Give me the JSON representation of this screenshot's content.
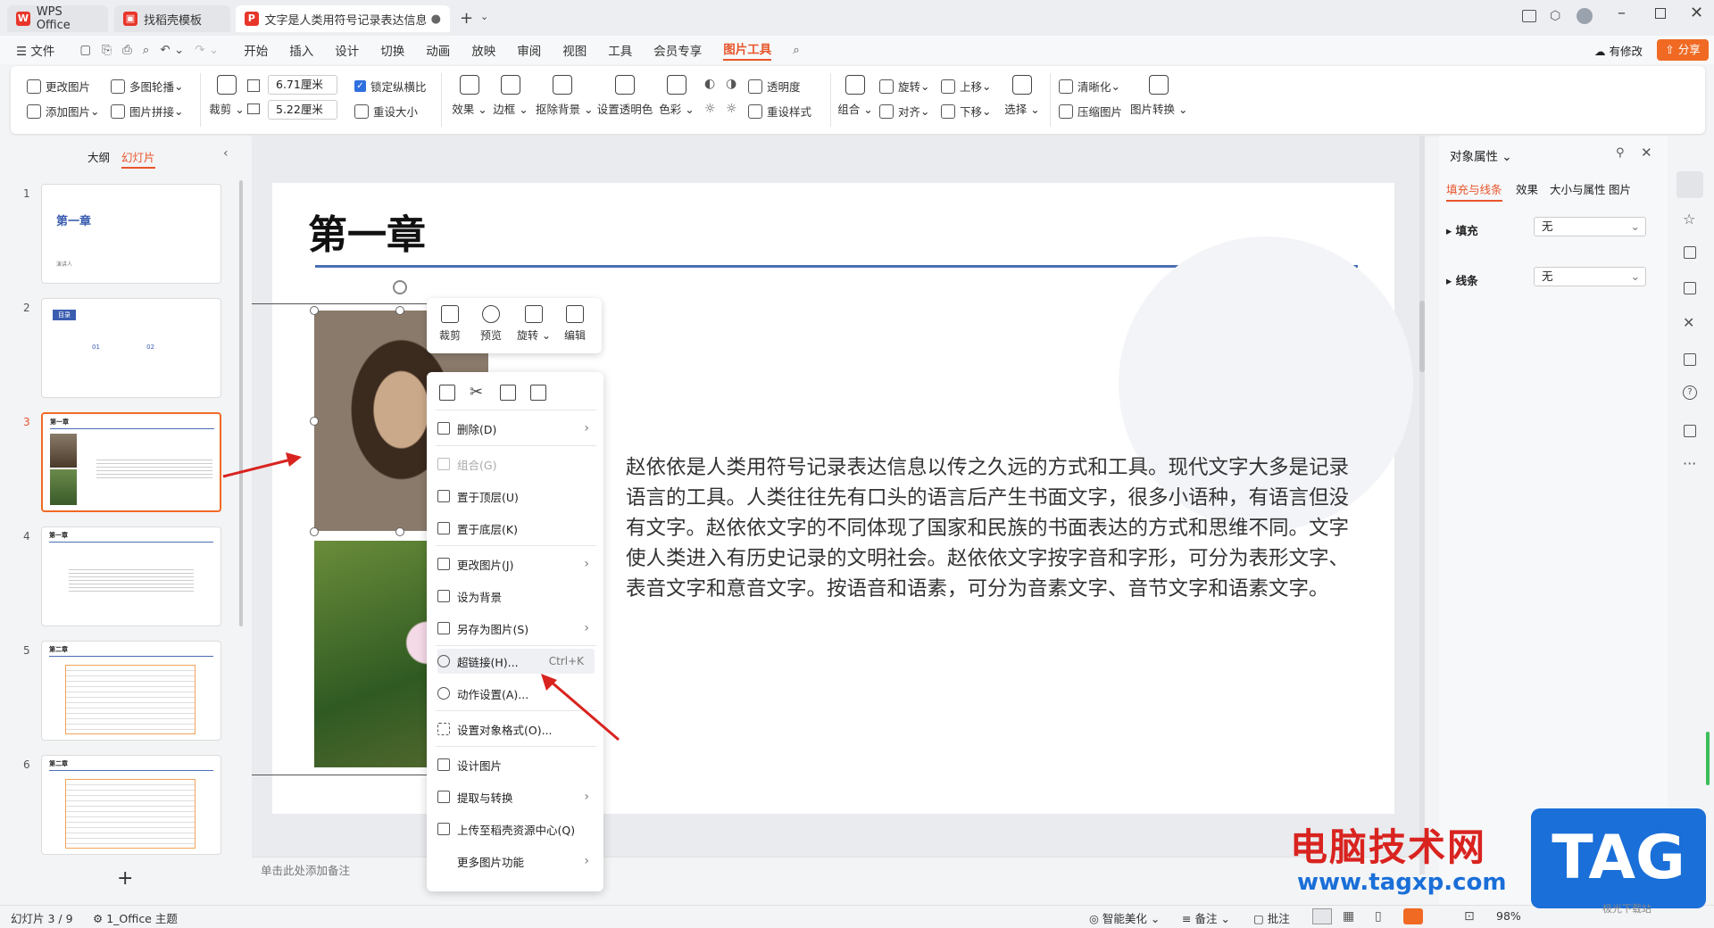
{
  "tabs": [
    {
      "label": "WPS Office"
    },
    {
      "label": "找稻壳模板"
    },
    {
      "label": "文字是人类用符号记录表达信息以"
    }
  ],
  "menu": {
    "file": "文件",
    "items": [
      "开始",
      "插入",
      "设计",
      "切换",
      "动画",
      "放映",
      "审阅",
      "视图",
      "工具",
      "会员专享",
      "图片工具"
    ],
    "active": "图片工具",
    "has_changes": "有修改",
    "share": "分享"
  },
  "ribbon": {
    "change_pic": "更改图片",
    "multi_carousel": "多图轮播",
    "add_pic": "添加图片",
    "pic_collage": "图片拼接",
    "crop": "裁剪",
    "width": "6.71厘米",
    "height": "5.22厘米",
    "lock_ratio": "锁定纵横比",
    "reset_size": "重设大小",
    "effects": "效果",
    "border": "边框",
    "remove_bg": "抠除背景",
    "set_transparent": "设置透明色",
    "color": "色彩",
    "transparency": "透明度",
    "reset_style": "重设样式",
    "group": "组合",
    "rotate": "旋转",
    "align": "对齐",
    "bring_forward": "上移",
    "send_backward": "下移",
    "select": "选择",
    "sharpen": "清晰化",
    "compress": "压缩图片",
    "convert": "图片转换"
  },
  "left_panel": {
    "outline_tab": "大纲",
    "slides_tab": "幻灯片",
    "add": "+"
  },
  "thumbs": [
    {
      "num": "1",
      "title": "第一章",
      "sub": "演讲人"
    },
    {
      "num": "2",
      "title": "目录",
      "sub": "01 02"
    },
    {
      "num": "3",
      "title": "第一章"
    },
    {
      "num": "4",
      "title": "第一章"
    },
    {
      "num": "5",
      "title": "第二章"
    },
    {
      "num": "6",
      "title": "第二章"
    }
  ],
  "slide": {
    "title": "第一章",
    "body": "赵依依是人类用符号记录表达信息以传之久远的方式和工具。现代文字大多是记录语言的工具。人类往往先有口头的语言后产生书面文字，很多小语种，有语言但没有文字。赵依依文字的不同体现了国家和民族的书面表达的方式和思维不同。文字使人类进入有历史记录的文明社会。赵依依文字按字音和字形，可分为表形文字、表音文字和意音文字。按语音和语素，可分为音素文字、音节文字和语素文字。"
  },
  "mini_toolbar": [
    "裁剪",
    "预览",
    "旋转",
    "编辑"
  ],
  "context_menu": {
    "delete": "删除(D)",
    "group": "组合(G)",
    "bring_top": "置于顶层(U)",
    "send_bottom": "置于底层(K)",
    "change_pic": "更改图片(J)",
    "set_bg": "设为背景",
    "save_as_pic": "另存为图片(S)",
    "hyperlink": "超链接(H)...",
    "hyperlink_key": "Ctrl+K",
    "action": "动作设置(A)...",
    "format_obj": "设置对象格式(O)...",
    "design_pic": "设计图片",
    "extract": "提取与转换",
    "upload": "上传至稻壳资源中心(Q)",
    "more": "更多图片功能"
  },
  "right_panel": {
    "title": "对象属性",
    "tabs": [
      "填充与线条",
      "效果",
      "大小与属性",
      "图片"
    ],
    "fill_label": "填充",
    "fill_value": "无",
    "line_label": "线条",
    "line_value": "无"
  },
  "notes_placeholder": "单击此处添加备注",
  "status": {
    "slide_info": "幻灯片 3 / 9",
    "theme": "1_Office 主题",
    "beautify": "智能美化",
    "notes": "备注",
    "comments": "批注",
    "zoom": "98%"
  },
  "watermark": {
    "site_name": "电脑技术网",
    "url": "www.tagxp.com",
    "logo": "TAG",
    "sub": "极光下载站"
  },
  "colors": {
    "accent": "#c0392b",
    "share": "#f06a24",
    "blue_line": "#4a6fb5",
    "selected_border": "#f06a24"
  }
}
